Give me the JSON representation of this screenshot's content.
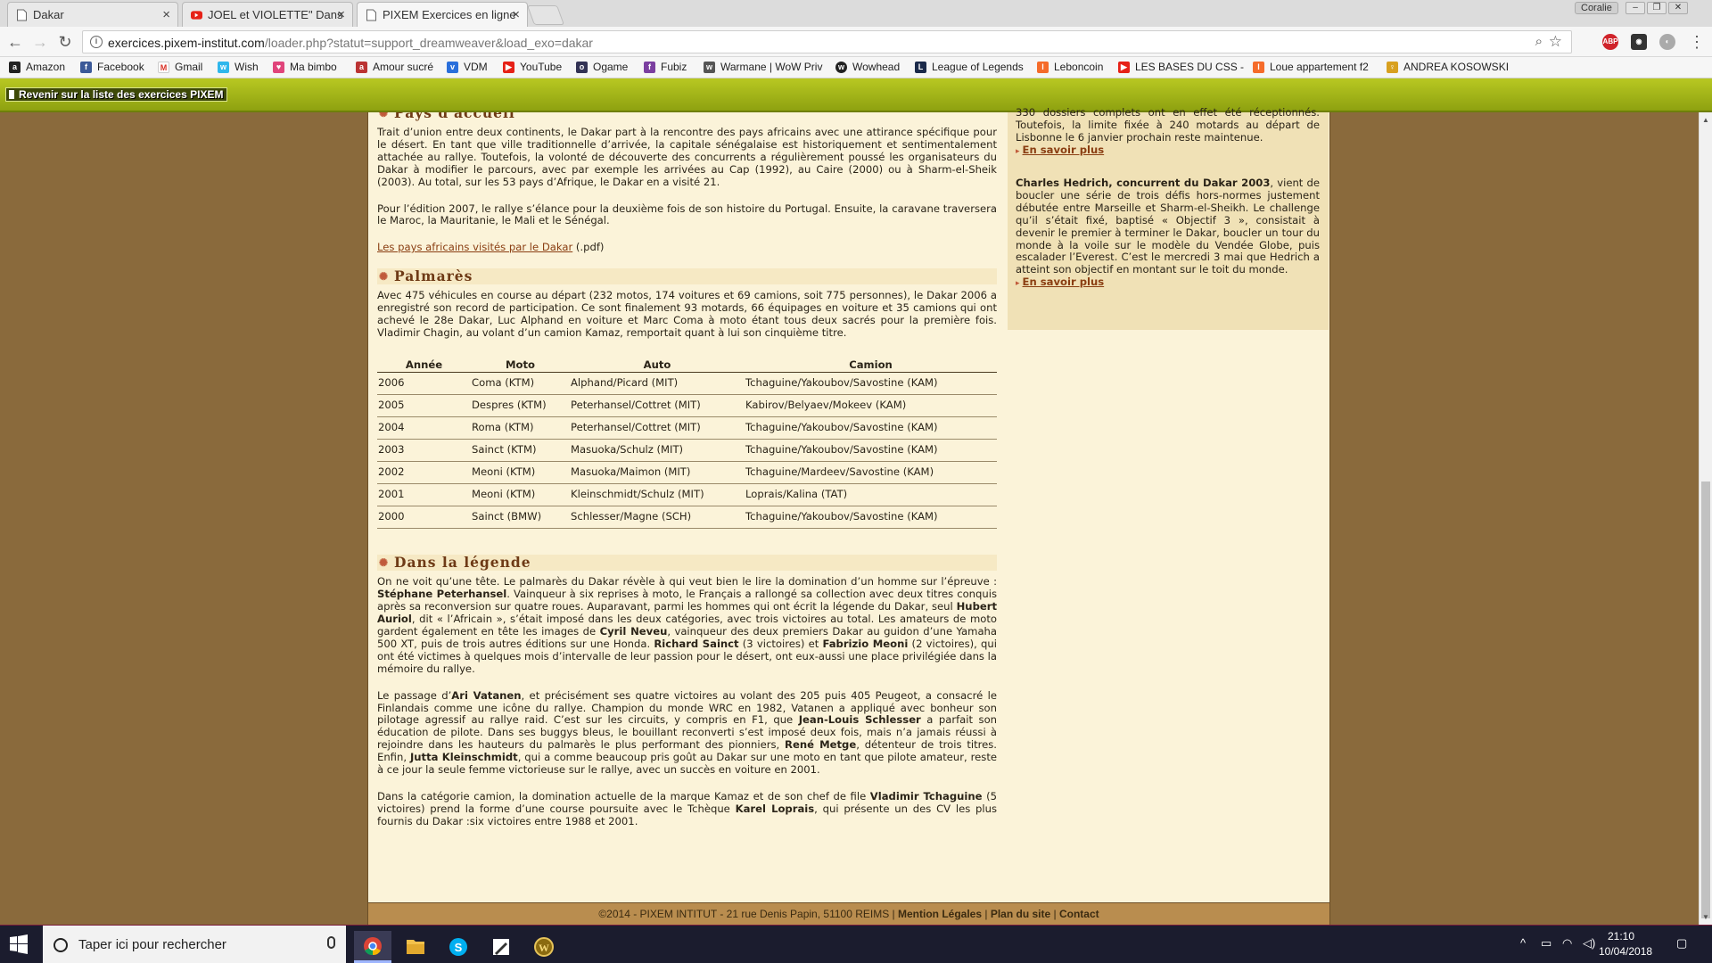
{
  "browser": {
    "tabs": [
      {
        "title": "Dakar"
      },
      {
        "title": "JOEL et VIOLETTE\" Dans"
      },
      {
        "title": "PIXEM Exercices en ligne"
      }
    ],
    "profile": "Coralie",
    "url_host": "exercices.pixem-institut.com",
    "url_path": "/loader.php?statut=support_dreamweaver&load_exo=dakar",
    "bookmarks": [
      "Amazon",
      "Facebook",
      "Gmail",
      "Wish",
      "Ma bimbo",
      "Amour sucré",
      "VDM",
      "YouTube",
      "Ogame",
      "Fubiz",
      "Warmane | WoW Priv",
      "Wowhead",
      "League of Legends",
      "Leboncoin",
      "LES BASES DU CSS -",
      "Loue appartement f2",
      "ANDREA KOSOWSKI"
    ]
  },
  "page": {
    "back_link": "Revenir sur la liste des exercices PIXEM",
    "section1_title": "Pays d'accueil",
    "section1_p1": "Trait d’union entre deux continents, le Dakar part à la rencontre des pays africains avec une attirance spécifique pour le désert. En tant que ville traditionnelle d’arrivée, la capitale sénégalaise est historiquement et sentimentalement attachée au rallye. Toutefois, la volonté de découverte des concurrents a régulièrement poussé les organisateurs du Dakar à modifier le parcours, avec par exemple les arrivées au Cap (1992), au Caire (2000) ou à Sharm-el-Sheik (2003). Au total, sur les 53 pays d’Afrique, le Dakar en a visité 21.",
    "section1_p2": "Pour l’édition 2007, le rallye s’élance pour la deuxième fois de son histoire du Portugal. Ensuite, la caravane traversera le Maroc, la Mauritanie, le Mali et le Sénégal.",
    "section1_link": "Les pays africains visités par le Dakar",
    "section1_link_suffix": " (.pdf)",
    "section2_title": "Palmarès",
    "section2_p1": "Avec 475 véhicules en course au départ (232 motos, 174 voitures et 69 camions, soit 775 personnes), le Dakar 2006 a enregistré son record de participation. Ce sont finalement 93 motards, 66 équipages en voiture et 35 camions qui ont achevé le 28e Dakar, Luc Alphand en voiture et Marc Coma à moto étant tous deux sacrés pour la première fois. Vladimir Chagin, au volant d’un camion Kamaz, remportait quant à lui son cinquième titre.",
    "table_headers": [
      "Année",
      "Moto",
      "Auto",
      "Camion"
    ],
    "table_rows": [
      [
        "2006",
        "Coma (KTM)",
        "Alphand/Picard (MIT)",
        "Tchaguine/Yakoubov/Savostine (KAM)"
      ],
      [
        "2005",
        "Despres (KTM)",
        "Peterhansel/Cottret (MIT)",
        "Kabirov/Belyaev/Mokeev (KAM)"
      ],
      [
        "2004",
        "Roma (KTM)",
        "Peterhansel/Cottret (MIT)",
        "Tchaguine/Yakoubov/Savostine (KAM)"
      ],
      [
        "2003",
        "Sainct (KTM)",
        "Masuoka/Schulz (MIT)",
        "Tchaguine/Yakoubov/Savostine (KAM)"
      ],
      [
        "2002",
        "Meoni (KTM)",
        "Masuoka/Maimon (MIT)",
        "Tchaguine/Mardeev/Savostine (KAM)"
      ],
      [
        "2001",
        "Meoni (KTM)",
        "Kleinschmidt/Schulz (MIT)",
        "Loprais/Kalina (TAT)"
      ],
      [
        "2000",
        "Sainct (BMW)",
        "Schlesser/Magne (SCH)",
        "Tchaguine/Yakoubov/Savostine (KAM)"
      ]
    ],
    "section3_title": "Dans la légende",
    "legend_p1": [
      {
        "t": "On ne voit qu’une tête. Le palmarès du Dakar révèle à qui veut bien le lire la domination d’un homme sur l’épreuve : "
      },
      {
        "t": "Stéphane Peterhansel",
        "b": true
      },
      {
        "t": ". Vainqueur à six reprises à moto, le Français a rallongé sa collection avec deux titres conquis après sa reconversion sur quatre roues. Auparavant, parmi les hommes qui ont écrit la légende du Dakar, seul "
      },
      {
        "t": "Hubert Auriol",
        "b": true
      },
      {
        "t": ", dit « l’Africain », s’était imposé dans les deux catégories, avec trois victoires au total. Les amateurs de moto gardent également en tête les images de "
      },
      {
        "t": "Cyril Neveu",
        "b": true
      },
      {
        "t": ", vainqueur des deux premiers Dakar au guidon d’une Yamaha 500 XT, puis de trois autres éditions sur une Honda. "
      },
      {
        "t": "Richard Sainct",
        "b": true
      },
      {
        "t": " (3 victoires) et "
      },
      {
        "t": "Fabrizio Meoni",
        "b": true
      },
      {
        "t": " (2 victoires), qui ont été victimes à quelques mois d’intervalle de leur passion pour le désert, ont eux-aussi une place privilégiée dans la mémoire du rallye."
      }
    ],
    "legend_p2": [
      {
        "t": "Le passage d’"
      },
      {
        "t": "Ari Vatanen",
        "b": true
      },
      {
        "t": ", et précisément ses quatre victoires au volant des 205 puis 405 Peugeot, a consacré le Finlandais comme une icône du rallye. Champion du monde WRC en 1982, Vatanen a appliqué avec bonheur son pilotage agressif au rallye raid. C’est sur les circuits, y compris en F1, que "
      },
      {
        "t": "Jean-Louis Schlesser",
        "b": true
      },
      {
        "t": " a parfait son éducation de pilote. Dans ses buggys bleus, le bouillant reconverti s’est imposé deux fois, mais n’a jamais réussi à rejoindre dans les hauteurs du palmarès le plus performant des pionniers, "
      },
      {
        "t": "René Metge",
        "b": true
      },
      {
        "t": ", détenteur de trois titres. Enfin, "
      },
      {
        "t": "Jutta Kleinschmidt",
        "b": true
      },
      {
        "t": ", qui a comme beaucoup pris goût au Dakar sur une moto en tant que pilote amateur, reste à ce jour la seule femme victorieuse sur le rallye, avec un succès en voiture en 2001."
      }
    ],
    "legend_p3": [
      {
        "t": "Dans la catégorie camion, la domination actuelle de la marque Kamaz et de son chef de file "
      },
      {
        "t": "Vladimir Tchaguine",
        "b": true
      },
      {
        "t": " (5 victoires) prend la forme d’une course poursuite avec le Tchèque "
      },
      {
        "t": "Karel Loprais",
        "b": true
      },
      {
        "t": ", qui présente un des CV les plus fournis du Dakar :six victoires entre 1988 et 2001."
      }
    ],
    "side_p1": "330 dossiers complets ont en effet été réceptionnés. Toutefois, la limite fixée à 240 motards au départ de Lisbonne le 6 janvier prochain reste maintenue.",
    "side_more1": "En savoir plus",
    "side_p2_bold": "Charles Hedrich, concurrent du Dakar 2003",
    "side_p2": ", vient de boucler une série de trois défis hors-normes justement débutée entre Marseille et Sharm-el-Sheikh. Le challenge qu’il s’était fixé, baptisé « Objectif 3 », consistait à devenir le premier à terminer le Dakar, boucler un tour du monde à la voile sur le modèle du Vendée Globe, puis escalader l’Everest. C’est le mercredi 3 mai que Hedrich a atteint son objectif en montant sur le toit du monde.",
    "side_more2": "En savoir plus",
    "footer_text": "©2014 - PIXEM INTITUT - 21 rue Denis Papin, 51100 REIMS | ",
    "footer_links": [
      "Mention Légales",
      "Plan du site",
      "Contact"
    ]
  },
  "taskbar": {
    "search_placeholder": "Taper ici pour rechercher",
    "time": "21:10",
    "date": "10/04/2018"
  }
}
